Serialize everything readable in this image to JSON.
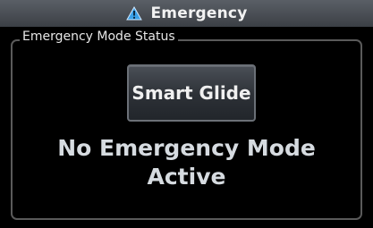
{
  "window": {
    "title": "Emergency",
    "title_icon": "warning-triangle-icon"
  },
  "panel": {
    "legend": "Emergency Mode Status"
  },
  "buttons": {
    "smart_glide_label": "Smart Glide"
  },
  "status": {
    "line1": "No Emergency Mode",
    "line2": "Active"
  },
  "colors": {
    "warning_icon": "#3aa0e8",
    "background": "#000000",
    "title_bar": "#4a4e55"
  }
}
